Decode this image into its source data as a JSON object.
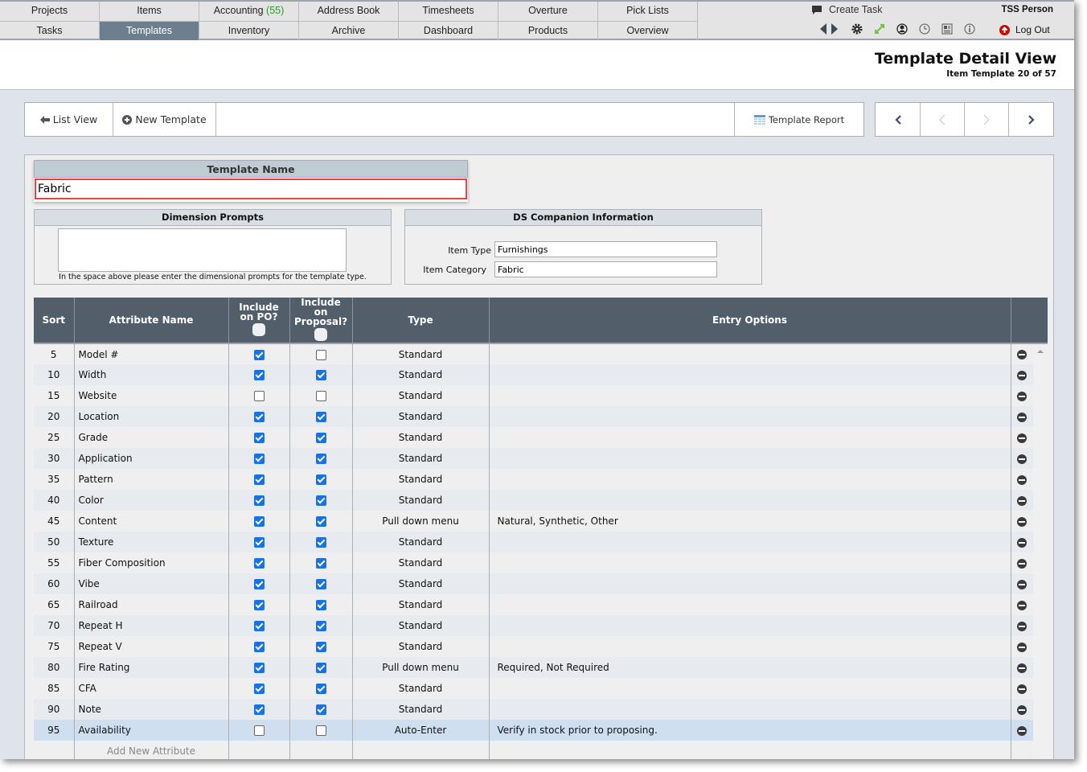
{
  "nav": {
    "row1": [
      {
        "label": "Projects"
      },
      {
        "label": "Items"
      },
      {
        "label": "Accounting",
        "count": "(55)"
      },
      {
        "label": "Address Book"
      },
      {
        "label": "Timesheets"
      },
      {
        "label": "Overture"
      },
      {
        "label": "Pick Lists"
      }
    ],
    "row2": [
      {
        "label": "Tasks"
      },
      {
        "label": "Templates",
        "active": true
      },
      {
        "label": "Inventory"
      },
      {
        "label": "Archive"
      },
      {
        "label": "Dashboard"
      },
      {
        "label": "Products"
      },
      {
        "label": "Overview"
      }
    ],
    "create_task": "Create Task",
    "user": "TSS Person",
    "logout": "Log Out"
  },
  "header": {
    "title": "Template Detail View",
    "subtitle": "Item Template 20 of 57"
  },
  "toolbar": {
    "list_view": "List View",
    "new_template": "New Template",
    "template_report": "Template Report"
  },
  "template_name": {
    "label": "Template Name",
    "value": "Fabric"
  },
  "dimension_prompts": {
    "label": "Dimension Prompts",
    "value": "",
    "hint": "In the space above please enter the dimensional prompts for the template type."
  },
  "ds_companion": {
    "label": "DS Companion Information",
    "item_type_label": "Item Type",
    "item_type": "Furnishings",
    "item_category_label": "Item Category",
    "item_category": "Fabric"
  },
  "table": {
    "headers": {
      "sort": "Sort",
      "name": "Attribute Name",
      "po": "Include on PO?",
      "proposal": "Include on Proposal?",
      "type": "Type",
      "entry": "Entry Options"
    },
    "rows": [
      {
        "sort": "5",
        "name": "Model #",
        "po": true,
        "proposal": false,
        "type": "Standard",
        "entry": ""
      },
      {
        "sort": "10",
        "name": "Width",
        "po": true,
        "proposal": true,
        "type": "Standard",
        "entry": ""
      },
      {
        "sort": "15",
        "name": "Website",
        "po": false,
        "proposal": false,
        "type": "Standard",
        "entry": ""
      },
      {
        "sort": "20",
        "name": "Location",
        "po": true,
        "proposal": true,
        "type": "Standard",
        "entry": ""
      },
      {
        "sort": "25",
        "name": "Grade",
        "po": true,
        "proposal": true,
        "type": "Standard",
        "entry": ""
      },
      {
        "sort": "30",
        "name": "Application",
        "po": true,
        "proposal": true,
        "type": "Standard",
        "entry": ""
      },
      {
        "sort": "35",
        "name": "Pattern",
        "po": true,
        "proposal": true,
        "type": "Standard",
        "entry": ""
      },
      {
        "sort": "40",
        "name": "Color",
        "po": true,
        "proposal": true,
        "type": "Standard",
        "entry": ""
      },
      {
        "sort": "45",
        "name": "Content",
        "po": true,
        "proposal": true,
        "type": "Pull down menu",
        "entry": "Natural, Synthetic, Other"
      },
      {
        "sort": "50",
        "name": "Texture",
        "po": true,
        "proposal": true,
        "type": "Standard",
        "entry": ""
      },
      {
        "sort": "55",
        "name": "Fiber Composition",
        "po": true,
        "proposal": true,
        "type": "Standard",
        "entry": ""
      },
      {
        "sort": "60",
        "name": "Vibe",
        "po": true,
        "proposal": true,
        "type": "Standard",
        "entry": ""
      },
      {
        "sort": "65",
        "name": "Railroad",
        "po": true,
        "proposal": true,
        "type": "Standard",
        "entry": ""
      },
      {
        "sort": "70",
        "name": "Repeat H",
        "po": true,
        "proposal": true,
        "type": "Standard",
        "entry": ""
      },
      {
        "sort": "75",
        "name": "Repeat V",
        "po": true,
        "proposal": true,
        "type": "Standard",
        "entry": ""
      },
      {
        "sort": "80",
        "name": "Fire Rating",
        "po": true,
        "proposal": true,
        "type": "Pull down menu",
        "entry": "Required, Not Required"
      },
      {
        "sort": "85",
        "name": "CFA",
        "po": true,
        "proposal": true,
        "type": "Standard",
        "entry": ""
      },
      {
        "sort": "90",
        "name": "Note",
        "po": true,
        "proposal": true,
        "type": "Standard",
        "entry": ""
      },
      {
        "sort": "95",
        "name": "Availability",
        "po": false,
        "proposal": false,
        "type": "Auto-Enter",
        "entry": "Verify in stock prior to proposing.",
        "selected": true
      }
    ],
    "add_new": "Add New Attribute"
  },
  "colors": {
    "active_tab": "#6c7f8e",
    "table_header": "#525e6a",
    "checkbox": "#1672e6",
    "highlight": "#e8414a",
    "count": "#2a9a2a"
  }
}
